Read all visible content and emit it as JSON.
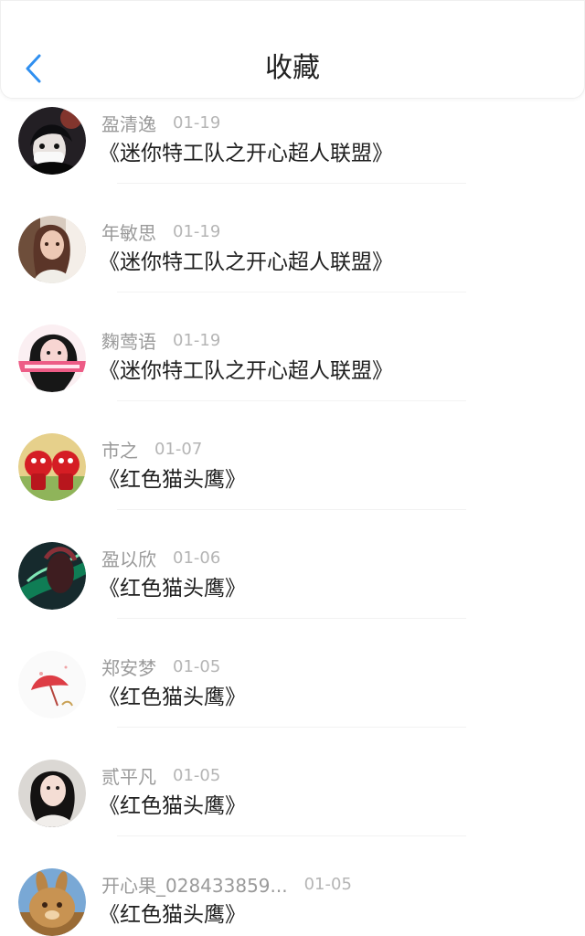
{
  "header": {
    "title": "收藏"
  },
  "colors": {
    "accent": "#2f8ff0",
    "title_text": "#222222",
    "name_text": "#9a9a9a",
    "date_text": "#b5b5b5",
    "divider": "#f2f2f2"
  },
  "items": [
    {
      "name": "盈清逸",
      "date": "01-19",
      "title": "《迷你特工队之开心超人联盟》",
      "avatar_icon": "dark-portrait-avatar-icon"
    },
    {
      "name": "年敏思",
      "date": "01-19",
      "title": "《迷你特工队之开心超人联盟》",
      "avatar_icon": "woman-portrait-avatar-icon"
    },
    {
      "name": "麴莺语",
      "date": "01-19",
      "title": "《迷你特工队之开心超人联盟》",
      "avatar_icon": "woman-selfie-avatar-icon"
    },
    {
      "name": "市之",
      "date": "01-07",
      "title": "《红色猫头鹰》",
      "avatar_icon": "red-cartoon-avatar-icon"
    },
    {
      "name": "盈以欣",
      "date": "01-06",
      "title": "《红色猫头鹰》",
      "avatar_icon": "dark-fantasy-avatar-icon"
    },
    {
      "name": "郑安梦",
      "date": "01-05",
      "title": "《红色猫头鹰》",
      "avatar_icon": "red-umbrella-avatar-icon"
    },
    {
      "name": "贰平凡",
      "date": "01-05",
      "title": "《红色猫头鹰》",
      "avatar_icon": "girl-portrait-avatar-icon"
    },
    {
      "name": "开心果_028433859...",
      "date": "01-05",
      "title": "《红色猫头鹰》",
      "avatar_icon": "rabbit-avatar-icon"
    }
  ]
}
